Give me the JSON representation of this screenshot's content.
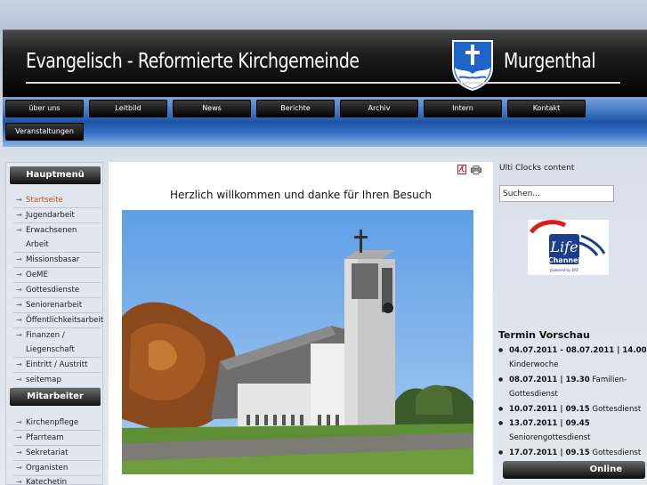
{
  "header": {
    "title_left": "Evangelisch - Reformierte Kirchgemeinde",
    "title_right": "Murgenthal"
  },
  "nav": {
    "row1": [
      "über uns",
      "Leitbild",
      "News",
      "Berichte",
      "Archiv",
      "Intern",
      "Kontakt"
    ],
    "row2": [
      "Veranstaltungen"
    ]
  },
  "sidebar": {
    "hauptmenu_title": "Hauptmenü",
    "hauptmenu": [
      "Startseite",
      "Jugendarbeit",
      "Erwachsenen",
      "Arbeit",
      "Missionsbasar",
      "OeME",
      "Gottesdienste",
      "Seniorenarbeit",
      "Öffentlichkeitsarbeit",
      "Finanzen /",
      "Liegenschaft",
      "Eintritt / Austritt",
      "seitemap"
    ],
    "mitarbeiter_title": "Mitarbeiter",
    "mitarbeiter": [
      "Kirchenpflege",
      "Pfarrteam",
      "Sekretariat",
      "Organisten",
      "Katechetin"
    ]
  },
  "content": {
    "welcome": "Herzlich willkommen und danke für Ihren Besuch"
  },
  "right": {
    "ulti": "Ulti Clocks content",
    "search_value": "Suchen...",
    "logo_text_1": "Life",
    "logo_text_2": "Channel",
    "logo_text_3": "powered by ERF",
    "termin_title": "Termin Vorschau",
    "termine": [
      {
        "date": "04.07.2011 - 08.07.2011 | 14.00",
        "text": "Kinderwoche"
      },
      {
        "date": "08.07.2011 | 19.30",
        "text": "Familien-Gottesdienst"
      },
      {
        "date": "10.07.2011 | 09.15",
        "text": "Gottesdienst"
      },
      {
        "date": "13.07.2011 | 09.45",
        "text": "Seniorengottesdienst"
      },
      {
        "date": "17.07.2011 | 09.15",
        "text": "Gottesdienst"
      }
    ],
    "online": "Online"
  },
  "colors": {
    "accent_active": "#c8501a",
    "nav_band": "#1d55a6",
    "crest_blue": "#1e64c8"
  }
}
